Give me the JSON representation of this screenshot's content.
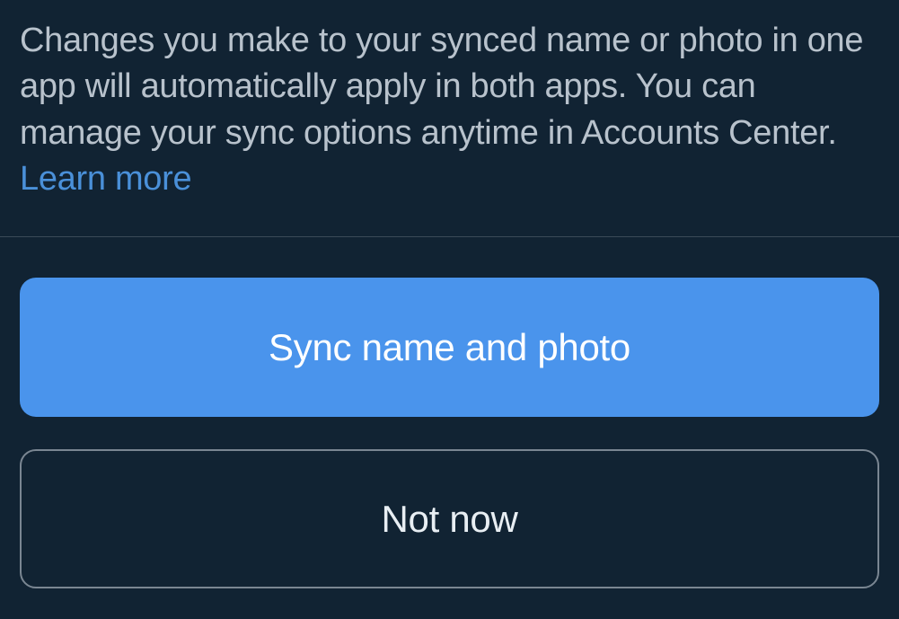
{
  "description": {
    "text": "Changes you make to your synced name or photo in one app will automatically apply in both apps. You can manage your sync options anytime in Accounts Center. ",
    "learn_more": "Learn more"
  },
  "buttons": {
    "primary_label": "Sync name and photo",
    "secondary_label": "Not now"
  }
}
